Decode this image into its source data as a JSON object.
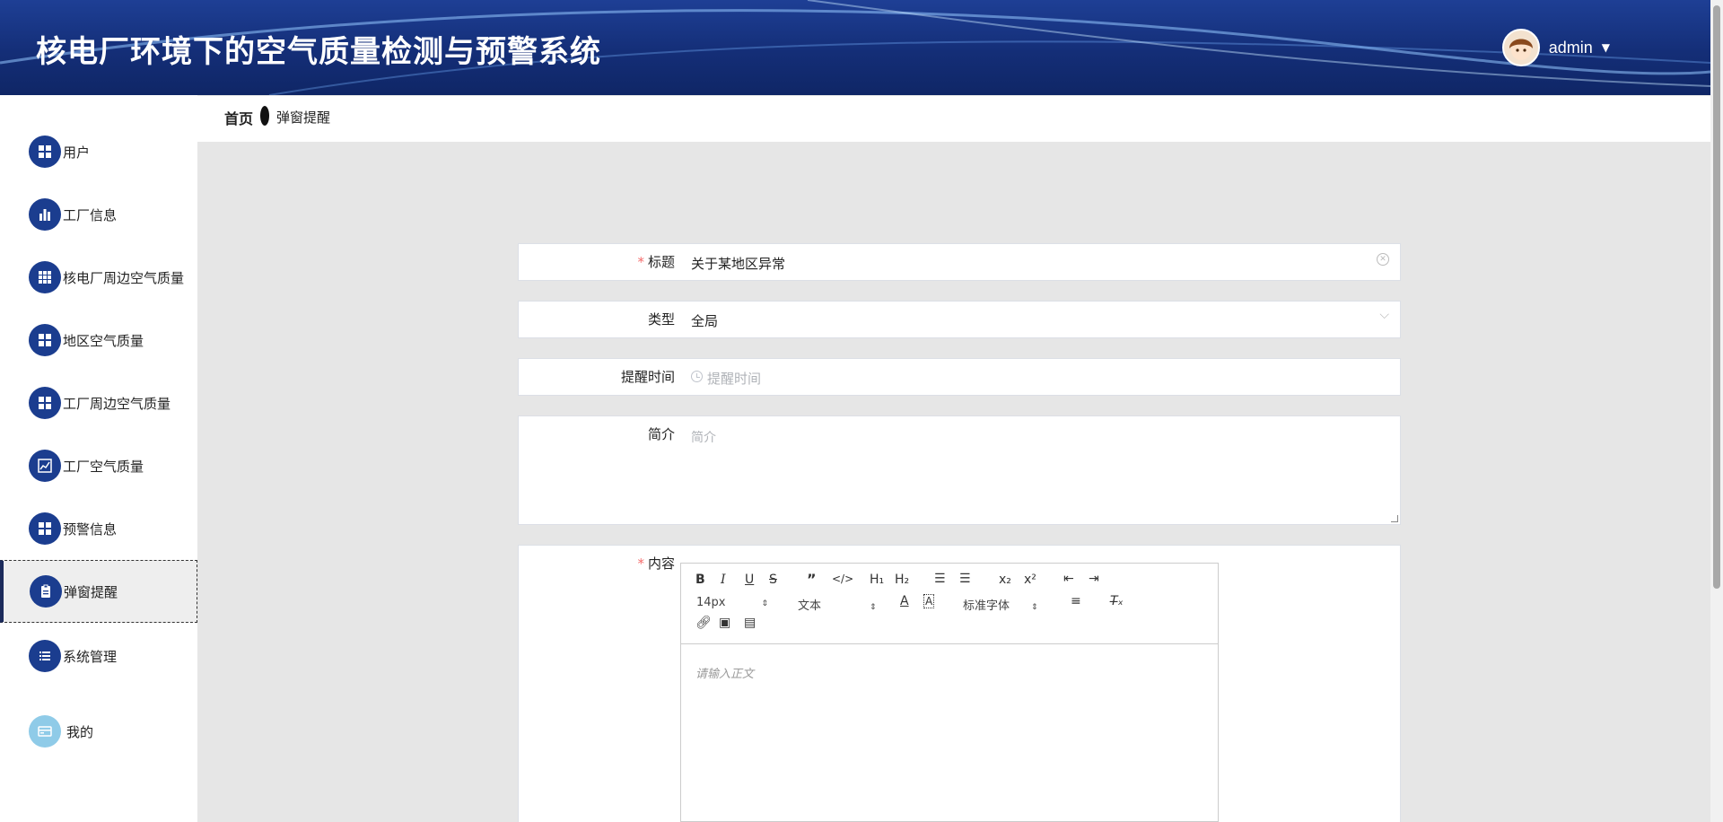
{
  "header": {
    "title": "核电厂环境下的空气质量检测与预警系统",
    "user_name": "admin",
    "caret": "▼"
  },
  "sidebar": {
    "items": [
      {
        "label": "用户",
        "icon": "grid-icon"
      },
      {
        "label": "工厂信息",
        "icon": "bar-chart-icon"
      },
      {
        "label": "核电厂周边空气质量",
        "icon": "table-icon"
      },
      {
        "label": "地区空气质量",
        "icon": "grid-icon"
      },
      {
        "label": "工厂周边空气质量",
        "icon": "grid-icon"
      },
      {
        "label": "工厂空气质量",
        "icon": "line-chart-icon"
      },
      {
        "label": "预警信息",
        "icon": "grid-icon"
      },
      {
        "label": "弹窗提醒",
        "icon": "clipboard-icon",
        "active": true
      },
      {
        "label": "系统管理",
        "icon": "list-icon"
      },
      {
        "label": "我的",
        "icon": "card-icon"
      }
    ]
  },
  "breadcrumb": {
    "home": "首页",
    "current": "弹窗提醒"
  },
  "form": {
    "title": {
      "label": "标题",
      "value": "关于某地区异常"
    },
    "type": {
      "label": "类型",
      "value": "全局"
    },
    "remind_time": {
      "label": "提醒时间",
      "placeholder": "提醒时间"
    },
    "summary": {
      "label": "简介",
      "placeholder": "简介"
    },
    "content": {
      "label": "内容"
    }
  },
  "editor": {
    "font_size": "14px",
    "text_style": "文本",
    "font_family": "标准字体",
    "placeholder": "请输入正文"
  },
  "colors": {
    "header_bg": "#142e77",
    "icon_bg": "#1b3d8f",
    "required": "#f56c6c"
  }
}
